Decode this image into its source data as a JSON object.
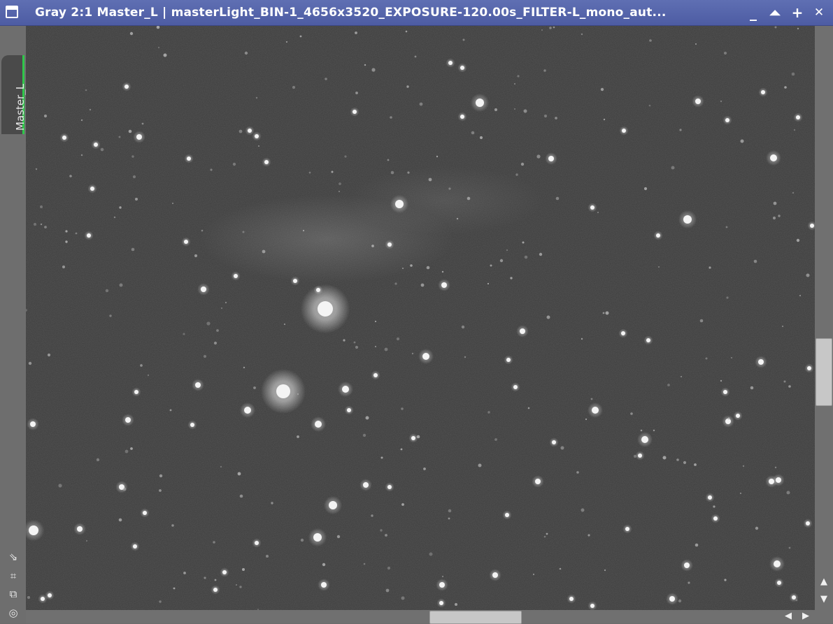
{
  "window": {
    "title": "Gray 2:1 Master_L | masterLight_BIN-1_4656x3520_EXPOSURE-120.00s_FILTER-L_mono_aut...",
    "controls": {
      "shade": "_",
      "maximize": "⏶",
      "expand": "+",
      "close": "✕"
    }
  },
  "view_tab": {
    "label": "Master_L",
    "accent_color": "#2fc74a"
  },
  "side_tools": [
    {
      "icon": "diagonal-arrow-icon",
      "glyph": "⇘"
    },
    {
      "icon": "fit-frame-icon",
      "glyph": "⌗"
    },
    {
      "icon": "clone-icon",
      "glyph": "⧉"
    },
    {
      "icon": "target-icon",
      "glyph": "◎"
    }
  ],
  "scrollbars": {
    "vertical": {
      "up": "▲",
      "down": "▼",
      "position": 0.52
    },
    "horizontal": {
      "left": "◀",
      "right": "▶",
      "position": 0.5
    }
  },
  "colors": {
    "titlebar": "#5566aa",
    "background": "#3d3d3d"
  }
}
